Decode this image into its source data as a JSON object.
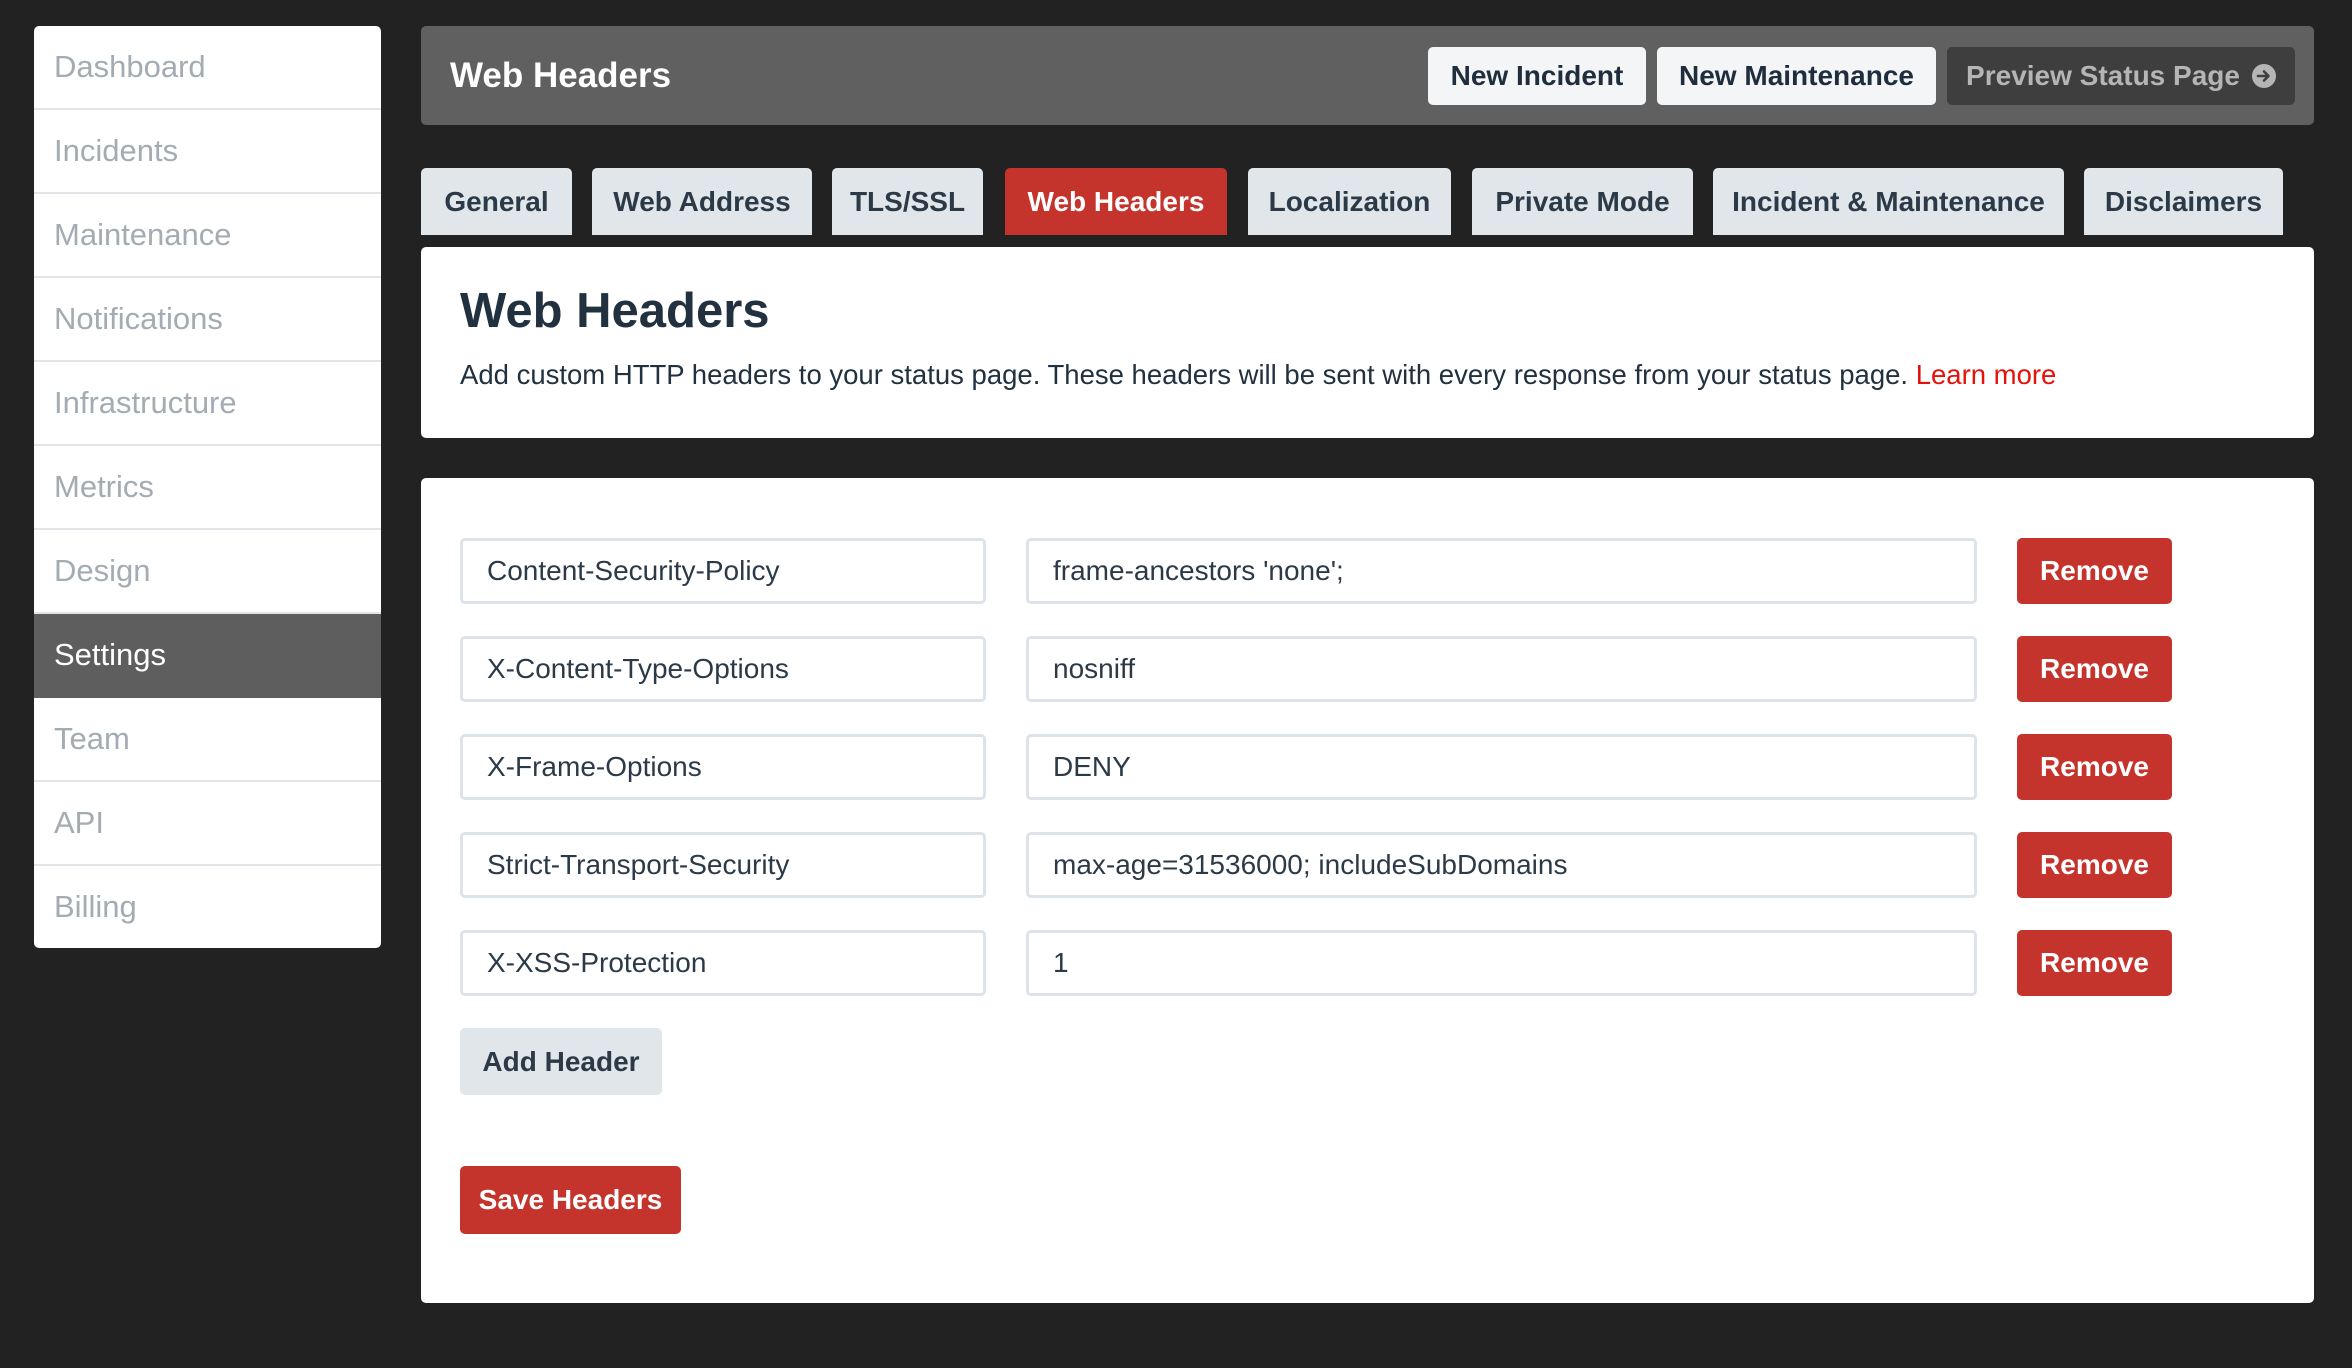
{
  "sidebar": {
    "items": [
      {
        "label": "Dashboard"
      },
      {
        "label": "Incidents"
      },
      {
        "label": "Maintenance"
      },
      {
        "label": "Notifications"
      },
      {
        "label": "Infrastructure"
      },
      {
        "label": "Metrics"
      },
      {
        "label": "Design"
      },
      {
        "label": "Settings",
        "active": true
      },
      {
        "label": "Team"
      },
      {
        "label": "API"
      },
      {
        "label": "Billing"
      }
    ]
  },
  "header": {
    "title": "Web Headers",
    "new_incident_label": "New Incident",
    "new_maintenance_label": "New Maintenance",
    "preview_label": "Preview Status Page",
    "preview_icon": "arrow-circle-right-icon"
  },
  "tabs": [
    {
      "label": "General"
    },
    {
      "label": "Web Address"
    },
    {
      "label": "TLS/SSL"
    },
    {
      "label": "Web Headers",
      "active": true
    },
    {
      "label": "Localization"
    },
    {
      "label": "Private Mode"
    },
    {
      "label": "Incident & Maintenance"
    },
    {
      "label": "Disclaimers"
    }
  ],
  "intro": {
    "title": "Web Headers",
    "description": "Add custom HTTP headers to your status page. These headers will be sent with every response from your status page.",
    "learn_more": "Learn more"
  },
  "headers": {
    "rows": [
      {
        "name": "Content-Security-Policy",
        "value": "frame-ancestors 'none';"
      },
      {
        "name": "X-Content-Type-Options",
        "value": "nosniff"
      },
      {
        "name": "X-Frame-Options",
        "value": "DENY"
      },
      {
        "name": "Strict-Transport-Security",
        "value": "max-age=31536000; includeSubDomains"
      },
      {
        "name": "X-XSS-Protection",
        "value": "1"
      }
    ],
    "remove_label": "Remove",
    "add_label": "Add Header",
    "save_label": "Save Headers"
  },
  "colors": {
    "accent": "#c4342d",
    "link": "#e3120b",
    "background": "#222222",
    "header_bar": "#606060"
  }
}
